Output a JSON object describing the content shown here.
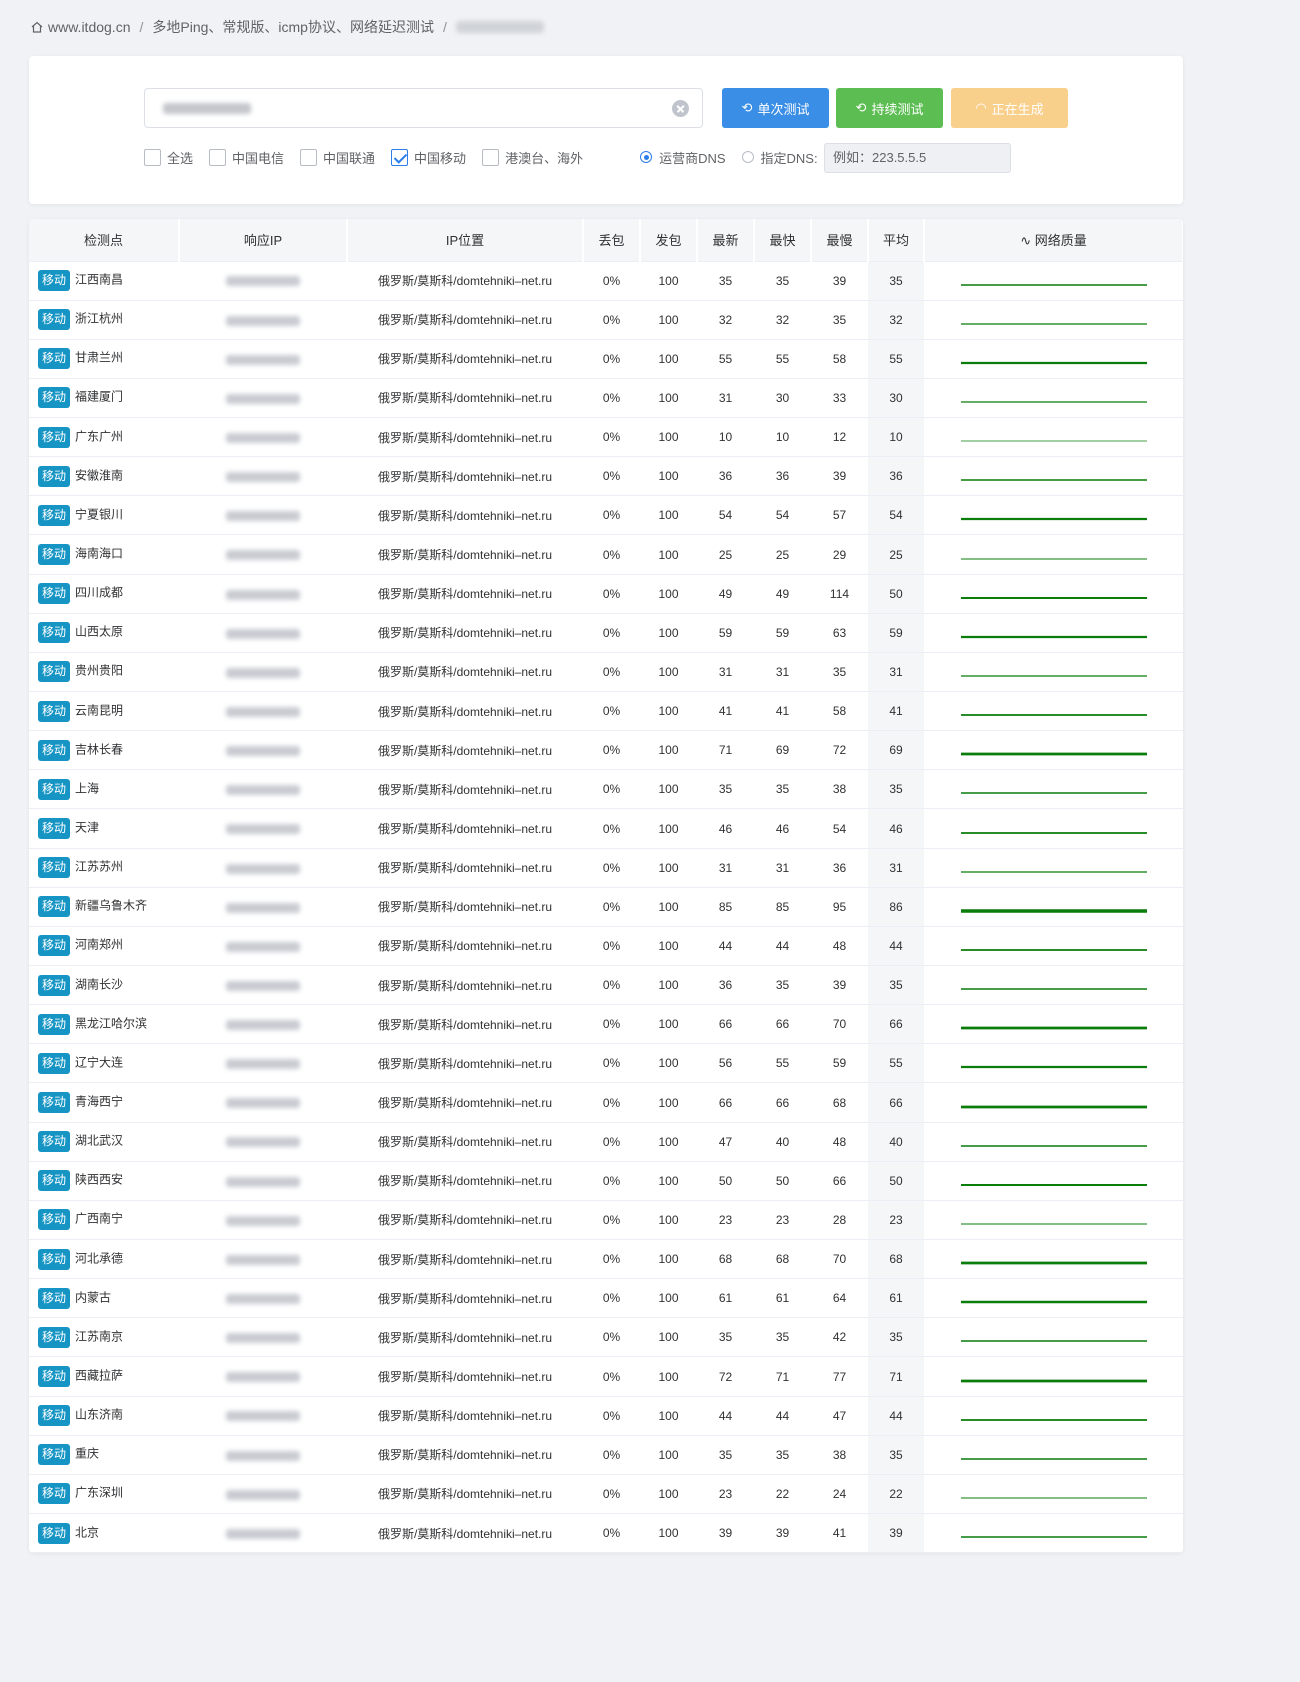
{
  "breadcrumb": {
    "home": "www.itdog.cn",
    "page": "多地Ping、常规版、icmp协议、网络延迟测试"
  },
  "toolbar": {
    "single_label": "单次测试",
    "continuous_label": "持续测试",
    "generating_label": "正在生成"
  },
  "filters": {
    "all": "全选",
    "telecom": "中国电信",
    "unicom": "中国联通",
    "mobile": "中国移动",
    "overseas": "港澳台、海外",
    "dns_carrier": "运营商DNS",
    "dns_custom": "指定DNS:",
    "dns_placeholder": "例如：223.5.5.5"
  },
  "colors": {
    "primary": "#3a8ee6",
    "success": "#5cbd52",
    "warning": "#f9cf8c",
    "tag": "#1695c4",
    "line": "#0a7d0a"
  },
  "table": {
    "headers": [
      "检测点",
      "响应IP",
      "IP位置",
      "丢包",
      "发包",
      "最新",
      "最快",
      "最慢",
      "平均",
      "网络质量"
    ],
    "rows": [
      {
        "tag": "移动",
        "node": "江西南昌",
        "loc": "俄罗斯/莫斯科/domtehniki–net.ru",
        "loss": "0%",
        "sent": "100",
        "last": "35",
        "best": "35",
        "worst": "39",
        "avg": "35"
      },
      {
        "tag": "移动",
        "node": "浙江杭州",
        "loc": "俄罗斯/莫斯科/domtehniki–net.ru",
        "loss": "0%",
        "sent": "100",
        "last": "32",
        "best": "32",
        "worst": "35",
        "avg": "32"
      },
      {
        "tag": "移动",
        "node": "甘肃兰州",
        "loc": "俄罗斯/莫斯科/domtehniki–net.ru",
        "loss": "0%",
        "sent": "100",
        "last": "55",
        "best": "55",
        "worst": "58",
        "avg": "55"
      },
      {
        "tag": "移动",
        "node": "福建厦门",
        "loc": "俄罗斯/莫斯科/domtehniki–net.ru",
        "loss": "0%",
        "sent": "100",
        "last": "31",
        "best": "30",
        "worst": "33",
        "avg": "30"
      },
      {
        "tag": "移动",
        "node": "广东广州",
        "loc": "俄罗斯/莫斯科/domtehniki–net.ru",
        "loss": "0%",
        "sent": "100",
        "last": "10",
        "best": "10",
        "worst": "12",
        "avg": "10"
      },
      {
        "tag": "移动",
        "node": "安徽淮南",
        "loc": "俄罗斯/莫斯科/domtehniki–net.ru",
        "loss": "0%",
        "sent": "100",
        "last": "36",
        "best": "36",
        "worst": "39",
        "avg": "36"
      },
      {
        "tag": "移动",
        "node": "宁夏银川",
        "loc": "俄罗斯/莫斯科/domtehniki–net.ru",
        "loss": "0%",
        "sent": "100",
        "last": "54",
        "best": "54",
        "worst": "57",
        "avg": "54"
      },
      {
        "tag": "移动",
        "node": "海南海口",
        "loc": "俄罗斯/莫斯科/domtehniki–net.ru",
        "loss": "0%",
        "sent": "100",
        "last": "25",
        "best": "25",
        "worst": "29",
        "avg": "25"
      },
      {
        "tag": "移动",
        "node": "四川成都",
        "loc": "俄罗斯/莫斯科/domtehniki–net.ru",
        "loss": "0%",
        "sent": "100",
        "last": "49",
        "best": "49",
        "worst": "114",
        "avg": "50"
      },
      {
        "tag": "移动",
        "node": "山西太原",
        "loc": "俄罗斯/莫斯科/domtehniki–net.ru",
        "loss": "0%",
        "sent": "100",
        "last": "59",
        "best": "59",
        "worst": "63",
        "avg": "59"
      },
      {
        "tag": "移动",
        "node": "贵州贵阳",
        "loc": "俄罗斯/莫斯科/domtehniki–net.ru",
        "loss": "0%",
        "sent": "100",
        "last": "31",
        "best": "31",
        "worst": "35",
        "avg": "31"
      },
      {
        "tag": "移动",
        "node": "云南昆明",
        "loc": "俄罗斯/莫斯科/domtehniki–net.ru",
        "loss": "0%",
        "sent": "100",
        "last": "41",
        "best": "41",
        "worst": "58",
        "avg": "41"
      },
      {
        "tag": "移动",
        "node": "吉林长春",
        "loc": "俄罗斯/莫斯科/domtehniki–net.ru",
        "loss": "0%",
        "sent": "100",
        "last": "71",
        "best": "69",
        "worst": "72",
        "avg": "69"
      },
      {
        "tag": "移动",
        "node": "上海",
        "loc": "俄罗斯/莫斯科/domtehniki–net.ru",
        "loss": "0%",
        "sent": "100",
        "last": "35",
        "best": "35",
        "worst": "38",
        "avg": "35"
      },
      {
        "tag": "移动",
        "node": "天津",
        "loc": "俄罗斯/莫斯科/domtehniki–net.ru",
        "loss": "0%",
        "sent": "100",
        "last": "46",
        "best": "46",
        "worst": "54",
        "avg": "46"
      },
      {
        "tag": "移动",
        "node": "江苏苏州",
        "loc": "俄罗斯/莫斯科/domtehniki–net.ru",
        "loss": "0%",
        "sent": "100",
        "last": "31",
        "best": "31",
        "worst": "36",
        "avg": "31"
      },
      {
        "tag": "移动",
        "node": "新疆乌鲁木齐",
        "loc": "俄罗斯/莫斯科/domtehniki–net.ru",
        "loss": "0%",
        "sent": "100",
        "last": "85",
        "best": "85",
        "worst": "95",
        "avg": "86"
      },
      {
        "tag": "移动",
        "node": "河南郑州",
        "loc": "俄罗斯/莫斯科/domtehniki–net.ru",
        "loss": "0%",
        "sent": "100",
        "last": "44",
        "best": "44",
        "worst": "48",
        "avg": "44"
      },
      {
        "tag": "移动",
        "node": "湖南长沙",
        "loc": "俄罗斯/莫斯科/domtehniki–net.ru",
        "loss": "0%",
        "sent": "100",
        "last": "36",
        "best": "35",
        "worst": "39",
        "avg": "35"
      },
      {
        "tag": "移动",
        "node": "黑龙江哈尔滨",
        "loc": "俄罗斯/莫斯科/domtehniki–net.ru",
        "loss": "0%",
        "sent": "100",
        "last": "66",
        "best": "66",
        "worst": "70",
        "avg": "66"
      },
      {
        "tag": "移动",
        "node": "辽宁大连",
        "loc": "俄罗斯/莫斯科/domtehniki–net.ru",
        "loss": "0%",
        "sent": "100",
        "last": "56",
        "best": "55",
        "worst": "59",
        "avg": "55"
      },
      {
        "tag": "移动",
        "node": "青海西宁",
        "loc": "俄罗斯/莫斯科/domtehniki–net.ru",
        "loss": "0%",
        "sent": "100",
        "last": "66",
        "best": "66",
        "worst": "68",
        "avg": "66"
      },
      {
        "tag": "移动",
        "node": "湖北武汉",
        "loc": "俄罗斯/莫斯科/domtehniki–net.ru",
        "loss": "0%",
        "sent": "100",
        "last": "47",
        "best": "40",
        "worst": "48",
        "avg": "40"
      },
      {
        "tag": "移动",
        "node": "陕西西安",
        "loc": "俄罗斯/莫斯科/domtehniki–net.ru",
        "loss": "0%",
        "sent": "100",
        "last": "50",
        "best": "50",
        "worst": "66",
        "avg": "50"
      },
      {
        "tag": "移动",
        "node": "广西南宁",
        "loc": "俄罗斯/莫斯科/domtehniki–net.ru",
        "loss": "0%",
        "sent": "100",
        "last": "23",
        "best": "23",
        "worst": "28",
        "avg": "23"
      },
      {
        "tag": "移动",
        "node": "河北承德",
        "loc": "俄罗斯/莫斯科/domtehniki–net.ru",
        "loss": "0%",
        "sent": "100",
        "last": "68",
        "best": "68",
        "worst": "70",
        "avg": "68"
      },
      {
        "tag": "移动",
        "node": "内蒙古",
        "loc": "俄罗斯/莫斯科/domtehniki–net.ru",
        "loss": "0%",
        "sent": "100",
        "last": "61",
        "best": "61",
        "worst": "64",
        "avg": "61"
      },
      {
        "tag": "移动",
        "node": "江苏南京",
        "loc": "俄罗斯/莫斯科/domtehniki–net.ru",
        "loss": "0%",
        "sent": "100",
        "last": "35",
        "best": "35",
        "worst": "42",
        "avg": "35"
      },
      {
        "tag": "移动",
        "node": "西藏拉萨",
        "loc": "俄罗斯/莫斯科/domtehniki–net.ru",
        "loss": "0%",
        "sent": "100",
        "last": "72",
        "best": "71",
        "worst": "77",
        "avg": "71"
      },
      {
        "tag": "移动",
        "node": "山东济南",
        "loc": "俄罗斯/莫斯科/domtehniki–net.ru",
        "loss": "0%",
        "sent": "100",
        "last": "44",
        "best": "44",
        "worst": "47",
        "avg": "44"
      },
      {
        "tag": "移动",
        "node": "重庆",
        "loc": "俄罗斯/莫斯科/domtehniki–net.ru",
        "loss": "0%",
        "sent": "100",
        "last": "35",
        "best": "35",
        "worst": "38",
        "avg": "35"
      },
      {
        "tag": "移动",
        "node": "广东深圳",
        "loc": "俄罗斯/莫斯科/domtehniki–net.ru",
        "loss": "0%",
        "sent": "100",
        "last": "23",
        "best": "22",
        "worst": "24",
        "avg": "22"
      },
      {
        "tag": "移动",
        "node": "北京",
        "loc": "俄罗斯/莫斯科/domtehniki–net.ru",
        "loss": "0%",
        "sent": "100",
        "last": "39",
        "best": "39",
        "worst": "41",
        "avg": "39"
      }
    ]
  }
}
